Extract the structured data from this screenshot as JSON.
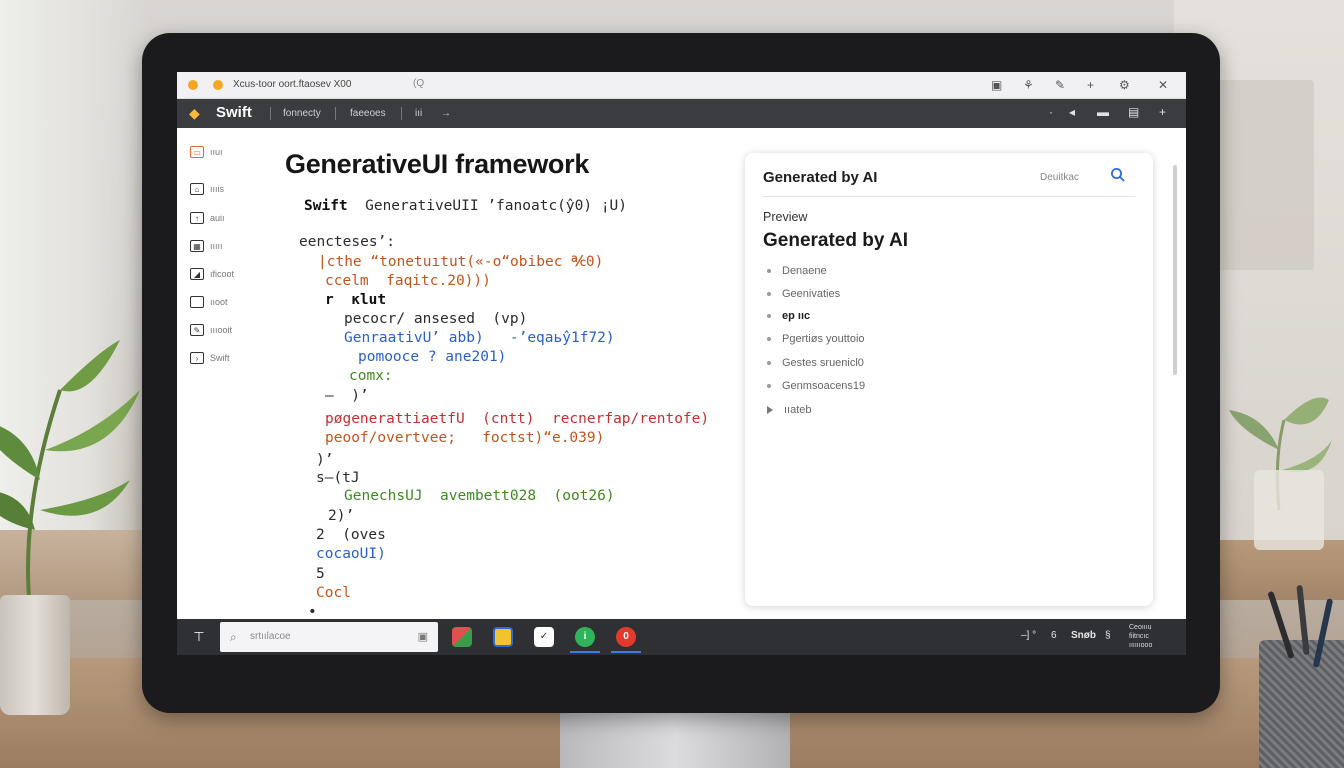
{
  "window": {
    "title": "Xcus-toor oort.ftaosev X00",
    "tab_close": "(Q"
  },
  "menubar": {
    "app_name": "Swift",
    "items": [
      "fonnecty",
      "faeeoes",
      "iıi",
      "→"
    ]
  },
  "sidebar": {
    "items": [
      {
        "label": "ııuı",
        "icon": "file-icon"
      },
      {
        "label": "ıııis",
        "icon": "account-icon"
      },
      {
        "label": "auiı",
        "icon": "bookmark-icon"
      },
      {
        "label": "ııııı",
        "icon": "grid-icon"
      },
      {
        "label": "ıficoot",
        "icon": "list-icon"
      },
      {
        "label": "ııoot",
        "icon": "box-icon"
      },
      {
        "label": "ıııooit",
        "icon": "edit-icon"
      },
      {
        "label": "Swift",
        "icon": "terminal-icon"
      }
    ]
  },
  "editor": {
    "title": "GenerativeUI framework",
    "header_line": {
      "kw": "Swift",
      "rest": "  GenerativeUII ’fanoatc(ŷ0) ¡U)"
    },
    "lines": [
      "еencteses’:",
      "|cthe “tonetuıtut(«-o“obibec ℀0)",
      "ccelm  faqitc.20)))",
      "r  ĸlut",
      "pecocr/ ansesed  (vp)",
      "GenraativU’ abb)   -’eqaьŷ1f72)",
      "pomooce ? ane201)",
      "comx:",
      "–  )’",
      "pøgenerattiaetfU  (cntt)  recnerfap/rentofe)",
      "peoof/overtvee;   foctst)“e.039)",
      ")’",
      "s–(tJ",
      "GenechsUJ  avembett028  (oot26)",
      "2)’",
      "2  (oves",
      "cocaoUI)",
      "5",
      "Cocl",
      "•"
    ]
  },
  "preview_panel": {
    "header_title": "Generated by AI",
    "header_action": "Deuitkac",
    "label": "Preview",
    "title": "Generated by AI",
    "items": [
      "Denaene",
      "Geenivaties",
      "ep  ııc",
      "Pgertiøs youttoio",
      "Gestes sruenicl0",
      "Genmsoacens19",
      "ııateb"
    ]
  },
  "taskbar": {
    "search_placeholder": "srtıılacoe",
    "tray_items": [
      "–] °",
      "6",
      "Snøb",
      "§"
    ],
    "clock_lines": [
      "Ceoıııu",
      "fiitncıc",
      "ııııııooo"
    ]
  },
  "colors": {
    "accent": "#f6b93b",
    "menubar": "#3b3c40",
    "taskbar": "#2f3034",
    "search_icon": "#2d6cdf"
  }
}
